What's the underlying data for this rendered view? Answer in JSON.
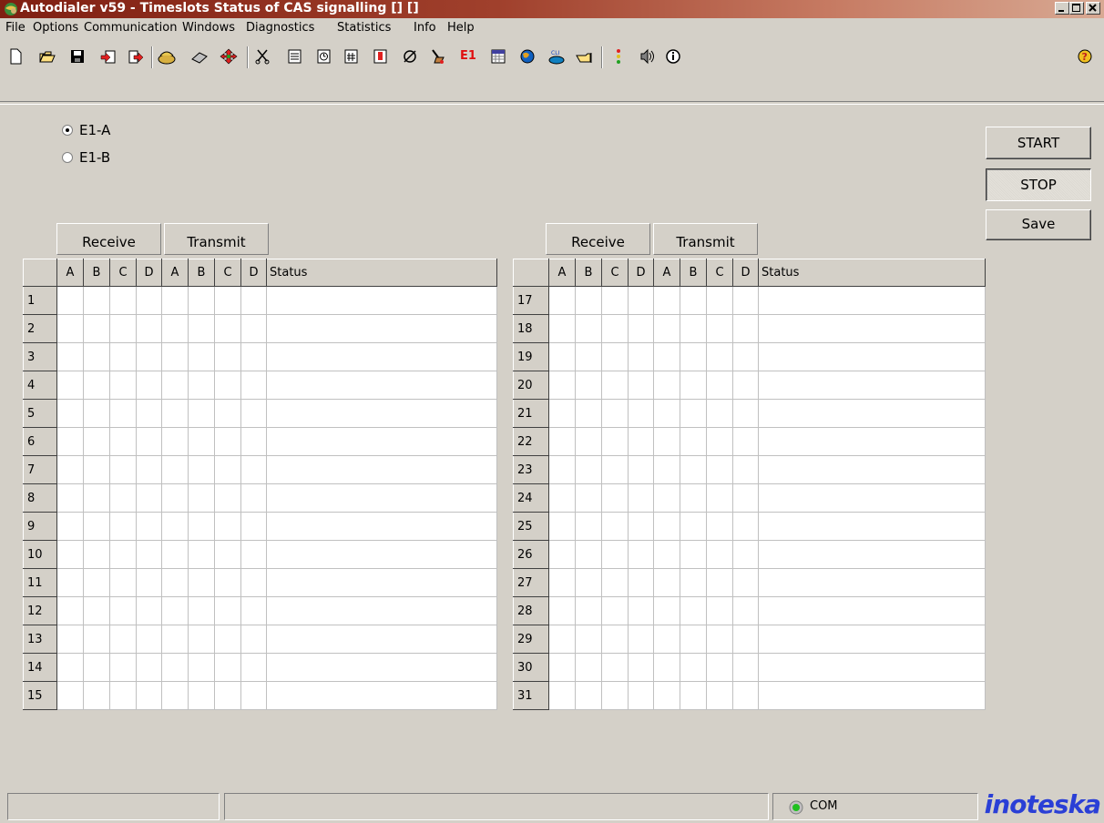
{
  "window": {
    "title": "Autodialer v59 - Timeslots Status of CAS signalling [] []",
    "controls": [
      "minimize-icon",
      "maximize-icon",
      "close-icon"
    ]
  },
  "menu": [
    "File",
    "Options",
    "Communication",
    "Windows",
    "Diagnostics",
    "Statistics",
    "Info",
    "Help"
  ],
  "toolbar": {
    "icons": [
      "new-document-icon",
      "open-folder-icon",
      "save-disk-icon",
      "import-icon",
      "export-icon",
      "phone-icon",
      "chip-icon",
      "move-arrows-icon",
      "scissors-icon",
      "notepad-icon",
      "clock-icon",
      "hash-icon",
      "alert-document-icon",
      "tools-icon",
      "broom-icon",
      "e1-icon",
      "calendar-icon",
      "globe-icon",
      "cli-phone-icon",
      "pointer-icon",
      "traffic-light-icon",
      "speaker-icon",
      "info-icon",
      "help-icon"
    ],
    "e1_label": "E1",
    "cli_label": "CLI"
  },
  "radios": [
    {
      "label": "E1-A",
      "checked": true
    },
    {
      "label": "E1-B",
      "checked": false
    }
  ],
  "buttons": {
    "start": "START",
    "stop": "STOP",
    "save": "Save"
  },
  "left_table": {
    "receive_label": "Receive",
    "transmit_label": "Transmit",
    "columns": [
      "A",
      "B",
      "C",
      "D",
      "A",
      "B",
      "C",
      "D",
      "Status"
    ],
    "rows": [
      "1",
      "2",
      "3",
      "4",
      "5",
      "6",
      "7",
      "8",
      "9",
      "10",
      "11",
      "12",
      "13",
      "14",
      "15"
    ]
  },
  "right_table": {
    "receive_label": "Receive",
    "transmit_label": "Transmit",
    "columns": [
      "A",
      "B",
      "C",
      "D",
      "A",
      "B",
      "C",
      "D",
      "Status"
    ],
    "rows": [
      "17",
      "18",
      "19",
      "20",
      "21",
      "22",
      "23",
      "24",
      "25",
      "26",
      "27",
      "28",
      "29",
      "30",
      "31"
    ]
  },
  "statusbar": {
    "com_label": "COM",
    "logo": "inoteska"
  },
  "colors": {
    "face": "#d4d0c8",
    "title_start": "#7f1f12",
    "title_end": "#d8a993",
    "logo": "#2a3fd6",
    "e1_red": "#e01010"
  }
}
